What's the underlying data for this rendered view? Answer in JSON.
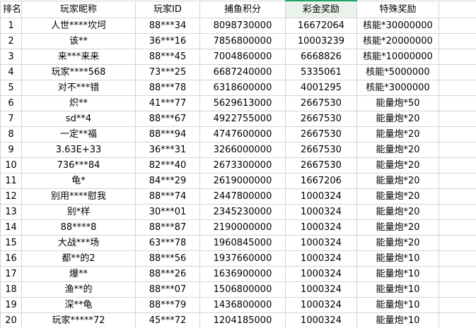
{
  "headers": {
    "rank": "排名",
    "nickname": "玩家昵称",
    "player_id": "玩家ID",
    "score": "捕鱼积分",
    "jackpot": "彩金奖励",
    "special": "特殊奖励"
  },
  "rows": [
    {
      "rank": "1",
      "nickname": "人世****坎坷",
      "player_id": "88***34",
      "score": "8098730000",
      "jackpot": "16672064",
      "special": "核能*30000000"
    },
    {
      "rank": "2",
      "nickname": "该**",
      "player_id": "36***16",
      "score": "7856800000",
      "jackpot": "10003239",
      "special": "核能*20000000"
    },
    {
      "rank": "3",
      "nickname": "来***来来",
      "player_id": "88***45",
      "score": "7004860000",
      "jackpot": "6668826",
      "special": "核能*10000000"
    },
    {
      "rank": "4",
      "nickname": "玩家****568",
      "player_id": "73***25",
      "score": "6687240000",
      "jackpot": "5335061",
      "special": "核能*5000000"
    },
    {
      "rank": "5",
      "nickname": "对不***错",
      "player_id": "88***78",
      "score": "6318600000",
      "jackpot": "4001295",
      "special": "核能*3000000"
    },
    {
      "rank": "6",
      "nickname": "炽**",
      "player_id": "41***77",
      "score": "5629613000",
      "jackpot": "2667530",
      "special": "能量炮*50"
    },
    {
      "rank": "7",
      "nickname": "sd**4",
      "player_id": "88***67",
      "score": "4922755000",
      "jackpot": "2667530",
      "special": "能量炮*20"
    },
    {
      "rank": "8",
      "nickname": "一定**福",
      "player_id": "88***94",
      "score": "4747600000",
      "jackpot": "2667530",
      "special": "能量炮*20"
    },
    {
      "rank": "9",
      "nickname": "3.63E+33",
      "player_id": "36***31",
      "score": "3266000000",
      "jackpot": "2667530",
      "special": "能量炮*20"
    },
    {
      "rank": "10",
      "nickname": "736***84",
      "player_id": "82***40",
      "score": "2673300000",
      "jackpot": "2667530",
      "special": "能量炮*20"
    },
    {
      "rank": "11",
      "nickname": "龟*",
      "player_id": "84***29",
      "score": "2619000000",
      "jackpot": "1667206",
      "special": "能量炮*20"
    },
    {
      "rank": "12",
      "nickname": "别用****慰我",
      "player_id": "88***74",
      "score": "2447800000",
      "jackpot": "1000324",
      "special": "能量炮*20"
    },
    {
      "rank": "13",
      "nickname": "别*样",
      "player_id": "30***01",
      "score": "2345230000",
      "jackpot": "1000324",
      "special": "能量炮*20"
    },
    {
      "rank": "14",
      "nickname": "88****8",
      "player_id": "88***87",
      "score": "2190000000",
      "jackpot": "1000324",
      "special": "能量炮*20"
    },
    {
      "rank": "15",
      "nickname": "大战***场",
      "player_id": "63***78",
      "score": "1960845000",
      "jackpot": "1000324",
      "special": "能量炮*20"
    },
    {
      "rank": "16",
      "nickname": "都**的2",
      "player_id": "88***56",
      "score": "1937660000",
      "jackpot": "1000324",
      "special": "能量炮*10"
    },
    {
      "rank": "17",
      "nickname": "爆**",
      "player_id": "88***26",
      "score": "1636900000",
      "jackpot": "1000324",
      "special": "能量炮*10"
    },
    {
      "rank": "18",
      "nickname": "渔**的",
      "player_id": "88***07",
      "score": "1506800000",
      "jackpot": "1000324",
      "special": "能量炮*10"
    },
    {
      "rank": "19",
      "nickname": "深**龟",
      "player_id": "88***79",
      "score": "1436800000",
      "jackpot": "1000324",
      "special": "能量炮*10"
    },
    {
      "rank": "20",
      "nickname": "玩家*****72",
      "player_id": "45***72",
      "score": "1204185000",
      "jackpot": "1000324",
      "special": "能量炮*10"
    }
  ]
}
